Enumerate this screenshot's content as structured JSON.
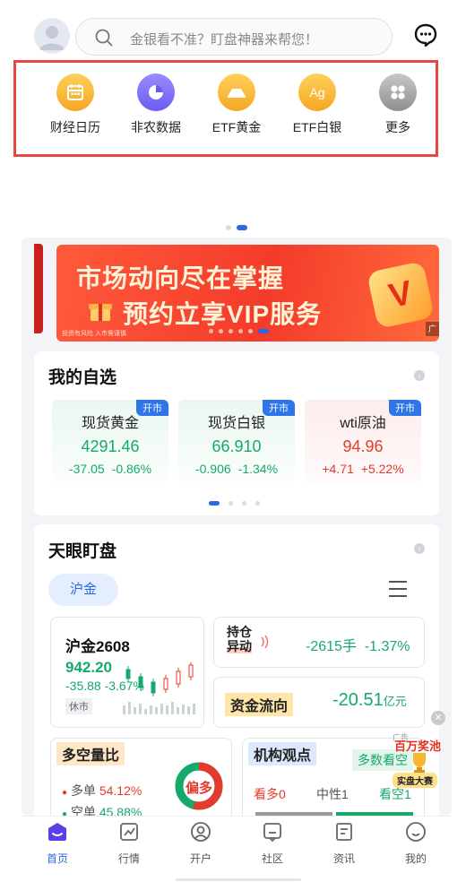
{
  "header": {
    "search_placeholder": "金银看不准？盯盘神器来帮您！"
  },
  "quick_entries": [
    {
      "label": "财经日历",
      "icon": "calendar-icon",
      "color": "#f5a623"
    },
    {
      "label": "非农数据",
      "icon": "pie-chart-icon",
      "color": "#6a5cf0"
    },
    {
      "label": "ETF黄金",
      "icon": "gold-ingot-icon",
      "color": "#f5a623"
    },
    {
      "label": "ETF白银",
      "icon_text": "Ag",
      "icon": "silver-ag-icon",
      "color": "#f5a623"
    },
    {
      "label": "更多",
      "icon": "more-grid-icon",
      "color": "#9a9a9a"
    }
  ],
  "banner": {
    "line1": "市场动向尽在掌握",
    "line2": "预约立享VIP服务",
    "disclaimer": "投资有风险 入市需谨慎",
    "badge": "V",
    "ad_tag": "广"
  },
  "watchlist": {
    "title": "我的自选",
    "open_label": "开市",
    "items": [
      {
        "name": "现货黄金",
        "price": "4291.46",
        "change": "-37.05",
        "change_pct": "-0.86%",
        "trend": "down"
      },
      {
        "name": "现货白银",
        "price": "66.910",
        "change": "-0.906",
        "change_pct": "-1.34%",
        "trend": "down"
      },
      {
        "name": "wti原油",
        "price": "94.96",
        "change": "+4.71",
        "change_pct": "+5.22%",
        "trend": "up"
      }
    ]
  },
  "monitor": {
    "title": "天眼盯盘",
    "tab": "沪金",
    "contract": {
      "name": "沪金2608",
      "price": "942.20",
      "change": "-35.88",
      "change_pct": "-3.67%",
      "status": "休市"
    },
    "position": {
      "label_line1": "持仓",
      "label_line2": "异动",
      "value": "-2615手",
      "pct": "-1.37%"
    },
    "fund_flow": {
      "label": "资金流向",
      "value": "-20.51",
      "unit": "亿元"
    },
    "long_short": {
      "title": "多空量比",
      "long_label": "多单",
      "long_value": "54.12%",
      "short_label": "空单",
      "short_value": "45.88%",
      "bias": "偏多"
    },
    "institution": {
      "title": "机构观点",
      "bullish_label": "多数看空",
      "bull": "看多0",
      "neutral": "中性1",
      "bear": "看空1"
    },
    "prize": {
      "line1": "百万奖池",
      "line2": "实盘大赛",
      "ad_tag": "广告"
    }
  },
  "bottom_nav": [
    {
      "label": "首页",
      "active": true
    },
    {
      "label": "行情"
    },
    {
      "label": "开户"
    },
    {
      "label": "社区"
    },
    {
      "label": "资讯"
    },
    {
      "label": "我的"
    }
  ]
}
